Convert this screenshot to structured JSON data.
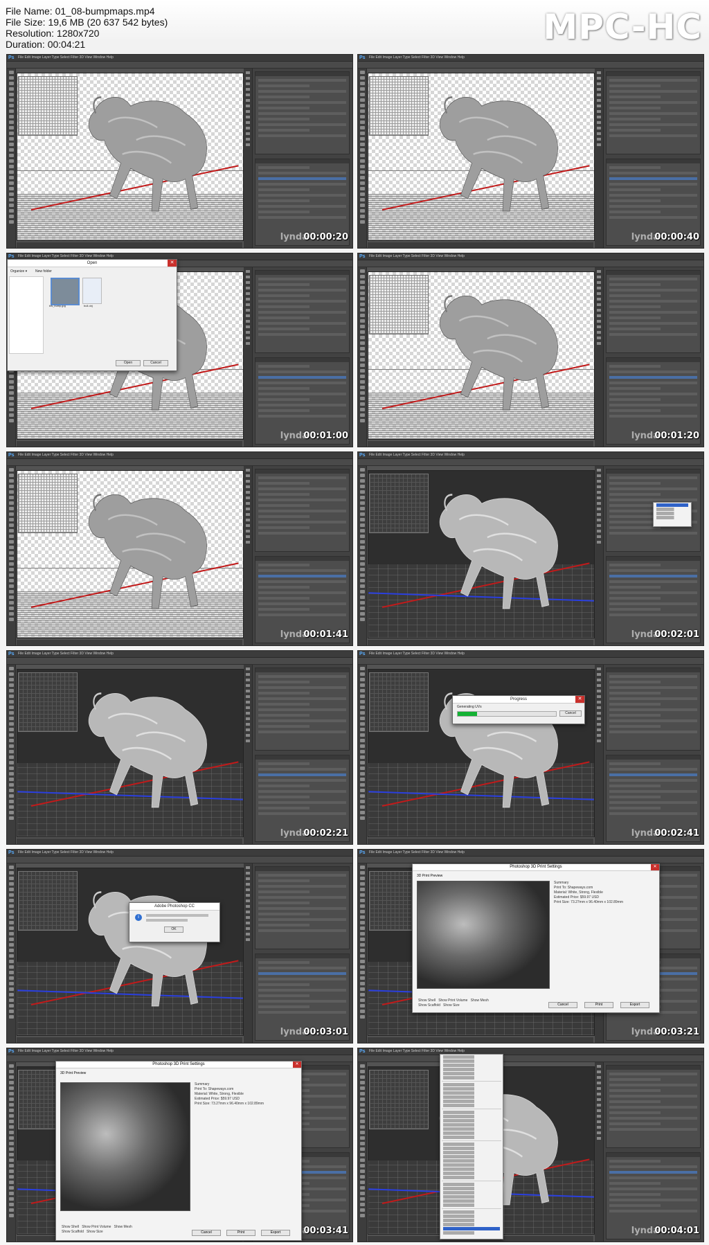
{
  "header": {
    "file_name": "File Name: 01_08-bumpmaps.mp4",
    "file_size": "File Size: 19,6 MB (20 637 542 bytes)",
    "resolution": "Resolution: 1280x720",
    "duration": "Duration: 00:04:21",
    "brand": "MPC-HC"
  },
  "app": {
    "logo": "Ps",
    "menus": "File  Edit  Image  Layer  Type  Select  Filter  3D  View  Window  Help",
    "watermark": "lynda"
  },
  "frames": [
    {
      "timestamp": "00:00:20",
      "scene": "light",
      "overlay": "none"
    },
    {
      "timestamp": "00:00:40",
      "scene": "light",
      "overlay": "none"
    },
    {
      "timestamp": "00:01:00",
      "scene": "light",
      "overlay": "open-dialog"
    },
    {
      "timestamp": "00:01:20",
      "scene": "light",
      "overlay": "none"
    },
    {
      "timestamp": "00:01:41",
      "scene": "light",
      "overlay": "none"
    },
    {
      "timestamp": "00:02:01",
      "scene": "dark",
      "overlay": "dropdown"
    },
    {
      "timestamp": "00:02:21",
      "scene": "dark",
      "overlay": "none"
    },
    {
      "timestamp": "00:02:41",
      "scene": "dark",
      "overlay": "progress"
    },
    {
      "timestamp": "00:03:01",
      "scene": "dark",
      "overlay": "alert"
    },
    {
      "timestamp": "00:03:21",
      "scene": "dark",
      "overlay": "print-settings"
    },
    {
      "timestamp": "00:03:41",
      "scene": "dark",
      "overlay": "print-settings-large"
    },
    {
      "timestamp": "00:04:01",
      "scene": "dark",
      "overlay": "3d-menu"
    }
  ],
  "dialogs": {
    "open_title": "Open",
    "open_organize": "Organize ▾",
    "open_new_folder": "New folder",
    "open_files": [
      "bw_bump.jpg",
      "bull.obj"
    ],
    "open_btn": "Open",
    "open_cancel": "Cancel",
    "progress_title": "Progress",
    "progress_text": "Generating UVs",
    "progress_cancel": "Cancel",
    "alert_title": "Adobe Photoshop CC",
    "alert_ok": "OK",
    "print_title": "Photoshop 3D Print Settings",
    "print_preview_label": "3D Print Preview",
    "print_summary": "Summary",
    "print_to": "Print To:  Shapeways.com",
    "print_material": "Material:  White, Strong, Flexible",
    "print_price": "Estimated Price:  $59.97 USD",
    "print_size": "Print Size:  73.27mm x 96.40mm x 102.89mm",
    "print_cancel": "Cancel",
    "print_print": "Print",
    "print_export": "Export",
    "print_show_shell": "Show Shell",
    "print_show_print_volume": "Show Print Volume",
    "print_show_mesh": "Show Mesh",
    "print_show_scaffold": "Show Scaffold",
    "print_show_size": "Show Size"
  }
}
